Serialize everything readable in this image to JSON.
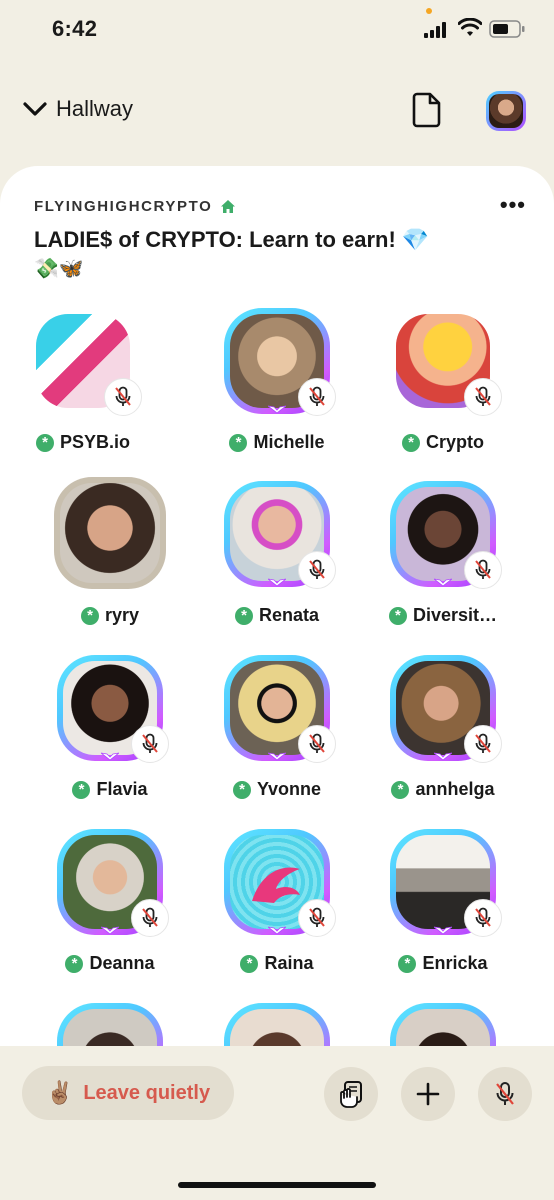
{
  "status_bar": {
    "time": "6:42"
  },
  "header": {
    "back_label": "Hallway"
  },
  "room": {
    "club_name": "FLYINGHIGHCRYPTO",
    "title": "LADIE$ of CRYPTO: Learn to earn! 💎",
    "title_emoji_line": "💸🦋"
  },
  "speakers": [
    {
      "name": "PSYB.io"
    },
    {
      "name": "Michelle"
    },
    {
      "name": "Crypto"
    },
    {
      "name": "ryry"
    },
    {
      "name": "Renata"
    },
    {
      "name": "Diversit…"
    },
    {
      "name": "Flavia"
    },
    {
      "name": "Yvonne"
    },
    {
      "name": "annhelga"
    },
    {
      "name": "Deanna"
    },
    {
      "name": "Raina"
    },
    {
      "name": "Enricka"
    }
  ],
  "bottom": {
    "leave_label": "Leave quietly",
    "leave_emoji": "✌🏽"
  },
  "colors": {
    "accent_green": "#3fae6a",
    "leave_red": "#d65a4e",
    "ring_cyan": "#5ee7ff",
    "ring_purple": "#b14cff"
  }
}
